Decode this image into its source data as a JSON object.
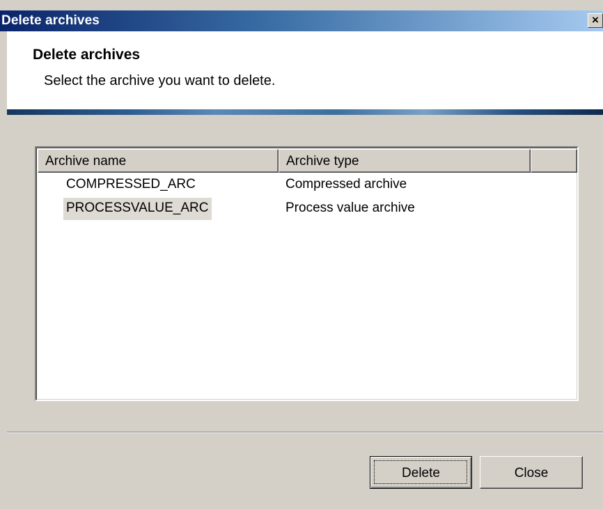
{
  "window": {
    "title": "Delete archives",
    "close_glyph": "×"
  },
  "header": {
    "title": "Delete archives",
    "subtitle": "Select the archive you want to delete."
  },
  "list": {
    "columns": [
      "Archive name",
      "Archive type",
      ""
    ],
    "rows": [
      {
        "name": "COMPRESSED_ARC",
        "type": "Compressed archive",
        "selected": false
      },
      {
        "name": "PROCESSVALUE_ARC",
        "type": "Process value archive",
        "selected": true
      }
    ]
  },
  "buttons": {
    "delete_label": "Delete",
    "close_label": "Close"
  },
  "colors": {
    "titlebar_start": "#0a246a",
    "titlebar_end": "#a6caf0",
    "face": "#d4d0c8",
    "selection": "#dedad4"
  }
}
